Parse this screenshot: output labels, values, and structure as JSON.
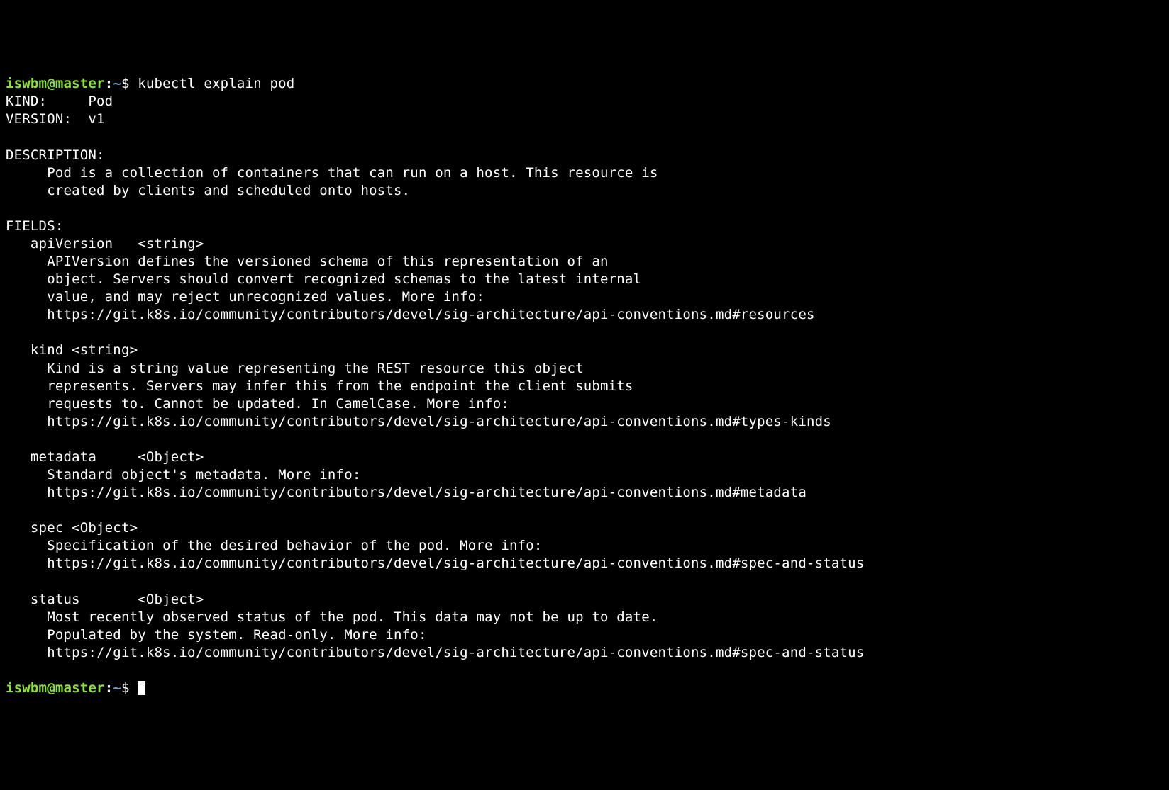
{
  "prompt": {
    "user": "iswbm",
    "at": "@",
    "host": "master",
    "colon": ":",
    "path": "~",
    "dollar": "$ "
  },
  "command": "kubectl explain pod",
  "output": {
    "kind_line": "KIND:     Pod",
    "version_line": "VERSION:  v1",
    "desc_header": "DESCRIPTION:",
    "desc_body": "     Pod is a collection of containers that can run on a host. This resource is\n     created by clients and scheduled onto hosts.",
    "fields_header": "FIELDS:",
    "fields": {
      "apiVersion": {
        "sig": "   apiVersion   <string>",
        "body": "     APIVersion defines the versioned schema of this representation of an\n     object. Servers should convert recognized schemas to the latest internal\n     value, and may reject unrecognized values. More info:\n     https://git.k8s.io/community/contributors/devel/sig-architecture/api-conventions.md#resources"
      },
      "kind": {
        "sig": "   kind <string>",
        "body": "     Kind is a string value representing the REST resource this object\n     represents. Servers may infer this from the endpoint the client submits\n     requests to. Cannot be updated. In CamelCase. More info:\n     https://git.k8s.io/community/contributors/devel/sig-architecture/api-conventions.md#types-kinds"
      },
      "metadata": {
        "sig": "   metadata     <Object>",
        "body": "     Standard object's metadata. More info:\n     https://git.k8s.io/community/contributors/devel/sig-architecture/api-conventions.md#metadata"
      },
      "spec": {
        "sig": "   spec <Object>",
        "body": "     Specification of the desired behavior of the pod. More info:\n     https://git.k8s.io/community/contributors/devel/sig-architecture/api-conventions.md#spec-and-status"
      },
      "status": {
        "sig": "   status       <Object>",
        "body": "     Most recently observed status of the pod. This data may not be up to date.\n     Populated by the system. Read-only. More info:\n     https://git.k8s.io/community/contributors/devel/sig-architecture/api-conventions.md#spec-and-status"
      }
    }
  }
}
